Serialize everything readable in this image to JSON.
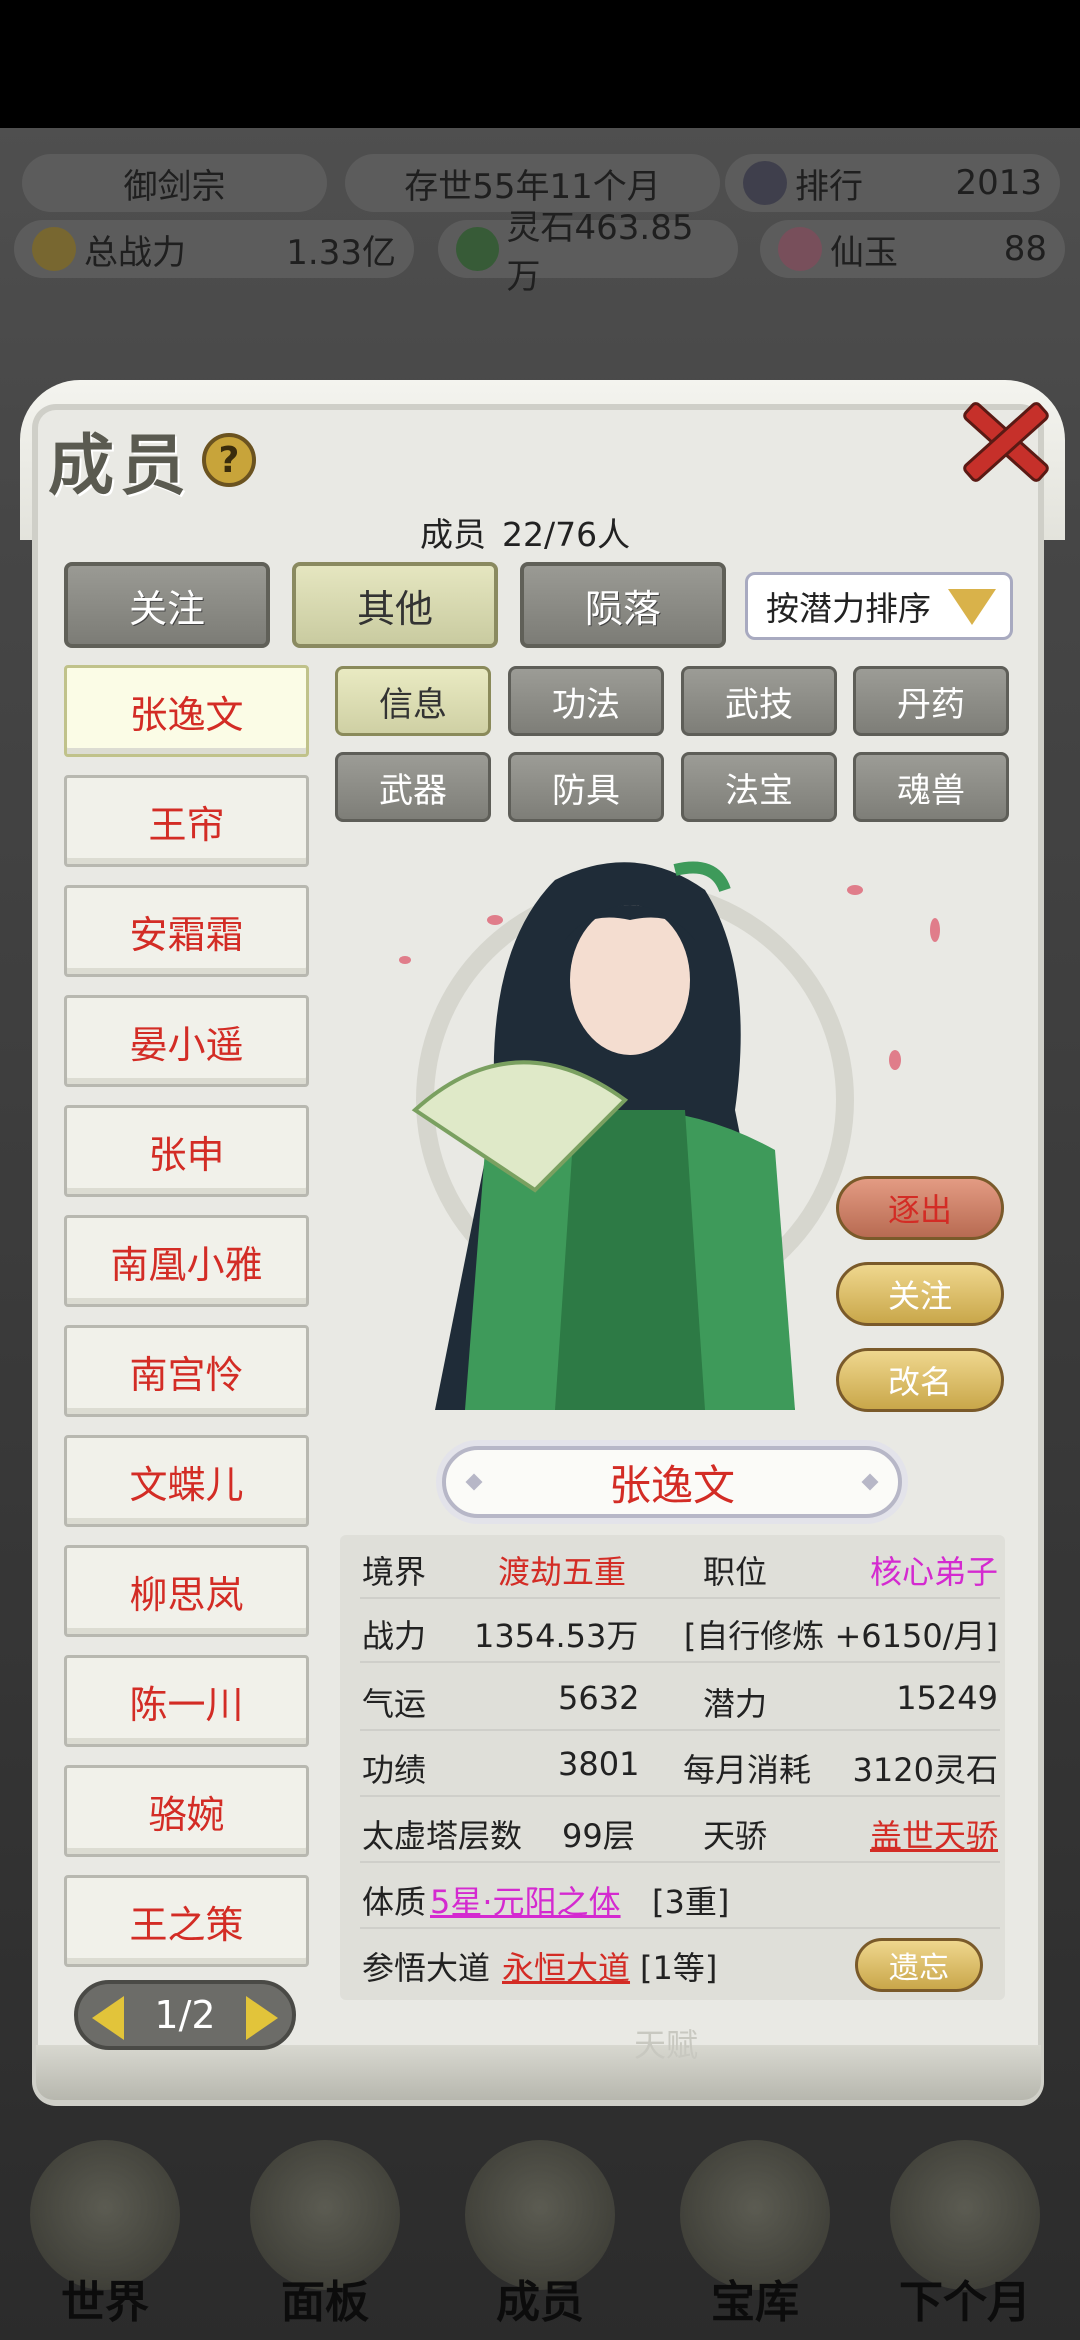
{
  "header": {
    "sect": "御剑宗",
    "time": "存世55年11个月",
    "rank_label": "排行",
    "rank_value": "2013",
    "power_label": "总战力",
    "power_value": "1.33亿",
    "stone_label": "灵石463.85万",
    "jade_label": "仙玉",
    "jade_value": "88"
  },
  "panel": {
    "title": "成员",
    "help": "?",
    "member_count_label": "成员",
    "member_count_value": "22/76人",
    "filters": [
      "关注",
      "其他",
      "陨落"
    ],
    "sort": "按潜力排序"
  },
  "members": [
    "张逸文",
    "王帘",
    "安霜霜",
    "晏小遥",
    "张申",
    "南凰小雅",
    "南宫怜",
    "文蝶儿",
    "柳思岚",
    "陈一川",
    "骆婉",
    "王之策"
  ],
  "pager": "1/2",
  "tabs": [
    "信息",
    "功法",
    "武技",
    "丹药",
    "武器",
    "防具",
    "法宝",
    "魂兽"
  ],
  "actions": {
    "expel": "逐出",
    "follow": "关注",
    "rename": "改名",
    "forget": "遗忘"
  },
  "character": {
    "name": "张逸文",
    "realm_label": "境界",
    "realm_value": "渡劫五重",
    "position_label": "职位",
    "position_value": "核心弟子",
    "power_label": "战力",
    "power_value": "1354.53万",
    "training": "[自行修炼 +6150/月]",
    "luck_label": "气运",
    "luck_value": "5632",
    "potential_label": "潜力",
    "potential_value": "15249",
    "merit_label": "功绩",
    "merit_value": "3801",
    "cost_label": "每月消耗",
    "cost_value": "3120灵石",
    "tower_label": "太虚塔层数",
    "tower_value": "99层",
    "talent_label": "天骄",
    "talent_value": "盖世天骄",
    "body_label": "体质",
    "body_value": "5星·元阳之体",
    "body_level": "[3重]",
    "dao_label": "参悟大道",
    "dao_value": "永恒大道",
    "dao_level": "[1等]"
  },
  "hidden_tab": "天赋",
  "nav": [
    "世界",
    "面板",
    "成员",
    "宝库",
    "下个月"
  ],
  "colors": {
    "accent_red": "#d32c25",
    "magenta": "#d42ad0",
    "gold": "#c9a74a"
  }
}
